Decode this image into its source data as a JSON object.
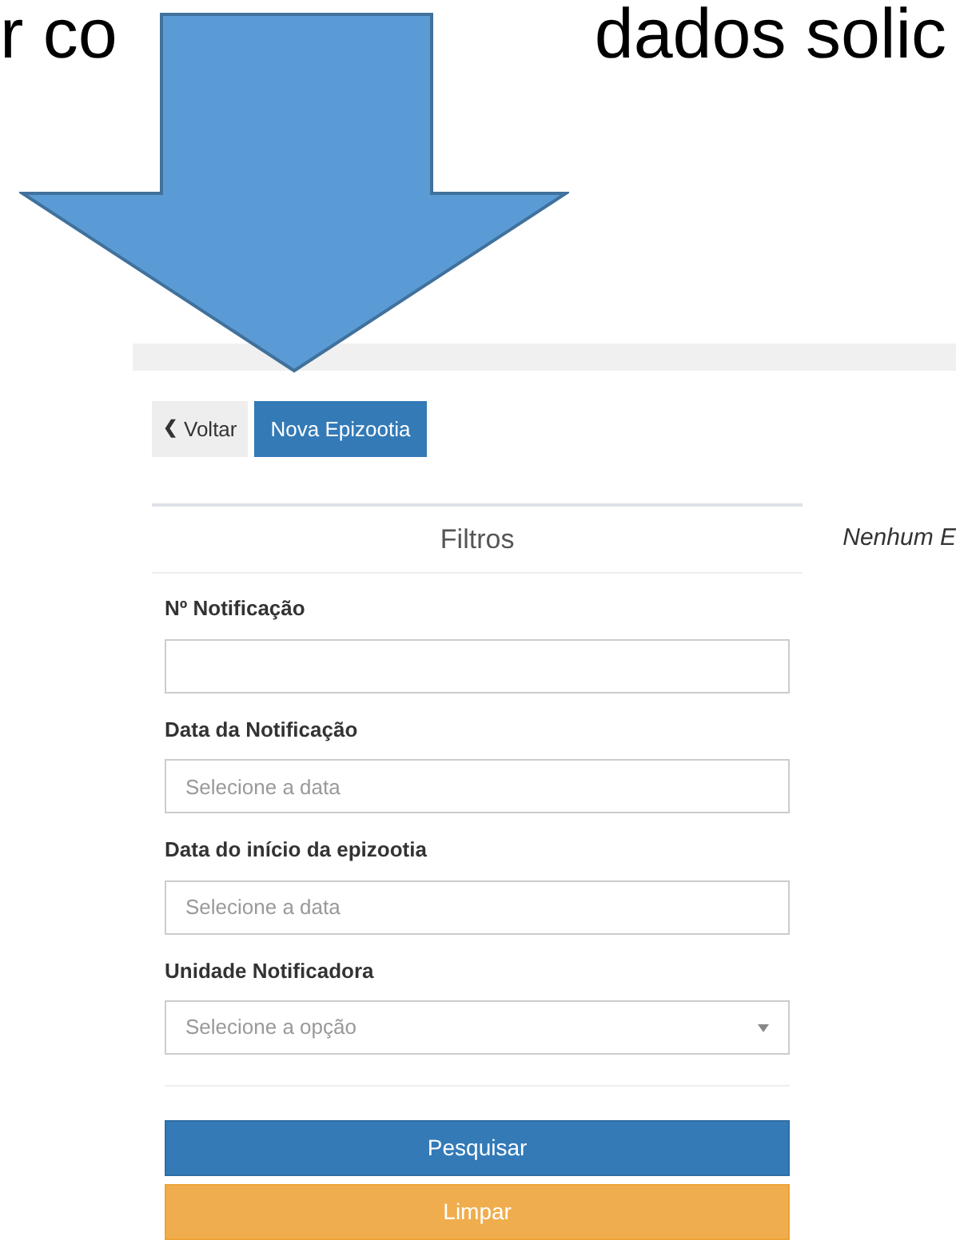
{
  "slide_caption_parts": [
    "r co",
    "dados solic"
  ],
  "toolbar": {
    "back_button": {
      "icon": "❮",
      "label": "Voltar"
    },
    "new_button": "Nova Epizootia"
  },
  "filters": {
    "title": "Filtros",
    "fields": [
      {
        "kind": "text",
        "label": "Nº Notificação"
      },
      {
        "kind": "date",
        "label": "Data da Notificação",
        "placeholder": "Selecione a data"
      },
      {
        "kind": "date",
        "label": "Data do início da epizootia",
        "placeholder": "Selecione a data"
      },
      {
        "kind": "select",
        "label": "Unidade Notificadora",
        "placeholder": "Selecione a opção"
      }
    ],
    "buttons": [
      {
        "kind": "primary",
        "label": "Pesquisar"
      },
      {
        "kind": "warning",
        "label": "Limpar"
      }
    ]
  },
  "results_message": "Nenhum E"
}
